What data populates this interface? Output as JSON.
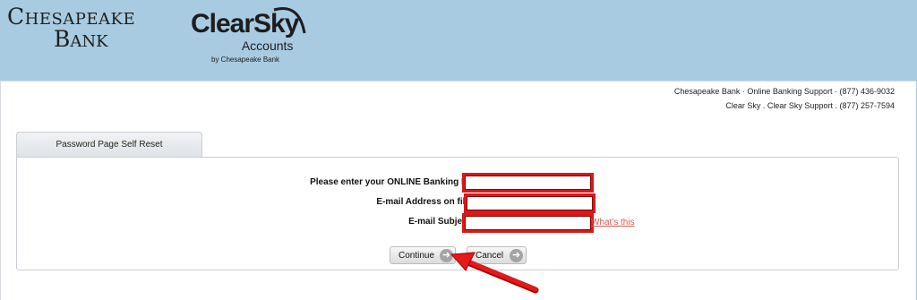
{
  "branding": {
    "chesapeake_line1": "Chesapeake",
    "chesapeake_line2": "Bank",
    "clearsky_main": "ClearSky",
    "clearsky_sub": "Accounts",
    "clearsky_by": "by Chesapeake Bank"
  },
  "support": {
    "line1": "Chesapeake Bank · Online Banking Support · (877) 436-9032",
    "line2": "Clear Sky . Clear Sky Support . (877) 257-7594"
  },
  "tab": {
    "label": "Password Page Self Reset"
  },
  "form": {
    "banking_id_label": "Please enter your ONLINE Banking ID",
    "banking_id_value": "",
    "email_label": "E-mail Address on file",
    "email_value": "",
    "subject_label": "E-mail Subject",
    "subject_value": "",
    "help_link": "What's this"
  },
  "buttons": {
    "continue_label": "Continue",
    "cancel_label": "Cancel"
  },
  "colors": {
    "header_bg": "#a8cbe2",
    "highlight": "#d61a1a",
    "link": "#e0584b"
  }
}
